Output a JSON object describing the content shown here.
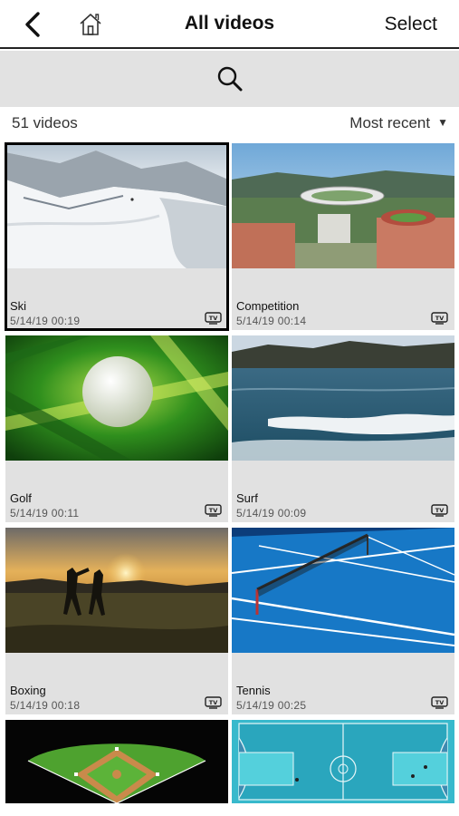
{
  "header": {
    "title": "All videos",
    "select_label": "Select"
  },
  "list": {
    "count_label": "51 videos",
    "sort_label": "Most recent"
  },
  "videos": [
    {
      "name": "Ski",
      "date": "5/14/19 00:19",
      "selected": true
    },
    {
      "name": "Competition",
      "date": "5/14/19 00:14"
    },
    {
      "name": "Golf",
      "date": "5/14/19 00:11"
    },
    {
      "name": "Surf",
      "date": "5/14/19 00:09"
    },
    {
      "name": "Boxing",
      "date": "5/14/19 00:18"
    },
    {
      "name": "Tennis",
      "date": "5/14/19 00:25"
    },
    {
      "name": "",
      "date": ""
    },
    {
      "name": "",
      "date": ""
    }
  ],
  "icons": {
    "back": "chevron-left-icon",
    "home": "home-icon",
    "search": "search-icon",
    "sort": "caret-down-icon",
    "tv": "tv-icon"
  },
  "colors": {
    "header_border": "#222222",
    "search_bg": "#e2e2e2",
    "tile_bg": "#e1e1e1"
  }
}
